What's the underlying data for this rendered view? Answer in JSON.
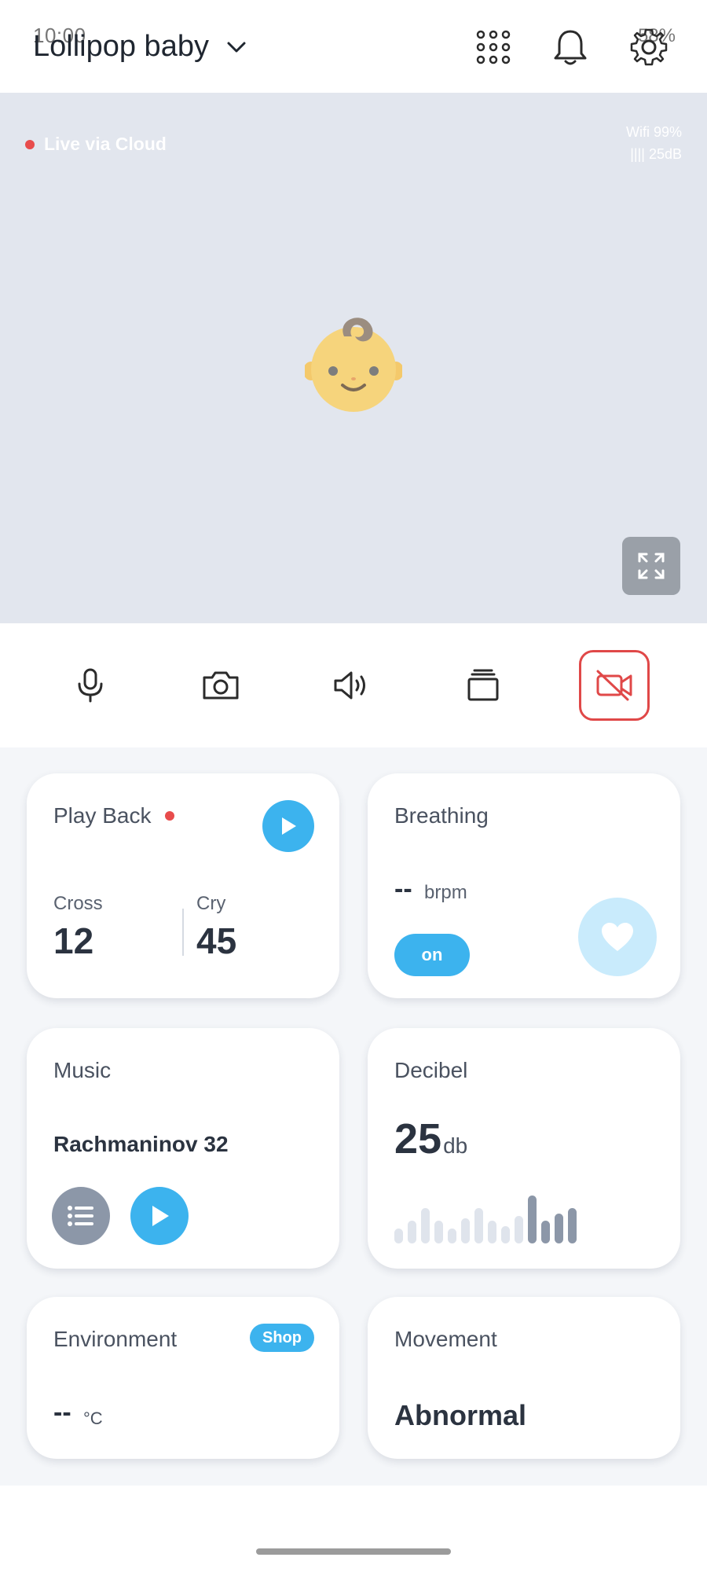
{
  "status_bar": {
    "time": "10:00",
    "battery": "58%"
  },
  "header": {
    "baby_name": "Lollipop baby"
  },
  "video": {
    "live_label": "Live via Cloud",
    "wifi": "Wifi 99%",
    "noise": "|||| 25dB"
  },
  "playback": {
    "title": "Play Back",
    "cross_label": "Cross",
    "cross_value": "12",
    "cry_label": "Cry",
    "cry_value": "45"
  },
  "breathing": {
    "title": "Breathing",
    "value": "--",
    "unit": "brpm",
    "toggle_label": "on"
  },
  "music": {
    "title": "Music",
    "track": "Rachmaninov 32"
  },
  "decibel": {
    "title": "Decibel",
    "value": "25",
    "unit": "db",
    "bar_levels": [
      0.3,
      0.45,
      0.7,
      0.45,
      0.3,
      0.5,
      0.7,
      0.45,
      0.35,
      0.55,
      0.95,
      0.45,
      0.6,
      0.7
    ],
    "bar_active_from": 10
  },
  "environment": {
    "title": "Environment",
    "shop_label": "Shop",
    "value": "--",
    "unit": "°C"
  },
  "movement": {
    "title": "Movement",
    "value": "Abnormal"
  },
  "colors": {
    "accent": "#3cb3ee",
    "alert": "#e04848",
    "muted": "#8c97a8"
  }
}
